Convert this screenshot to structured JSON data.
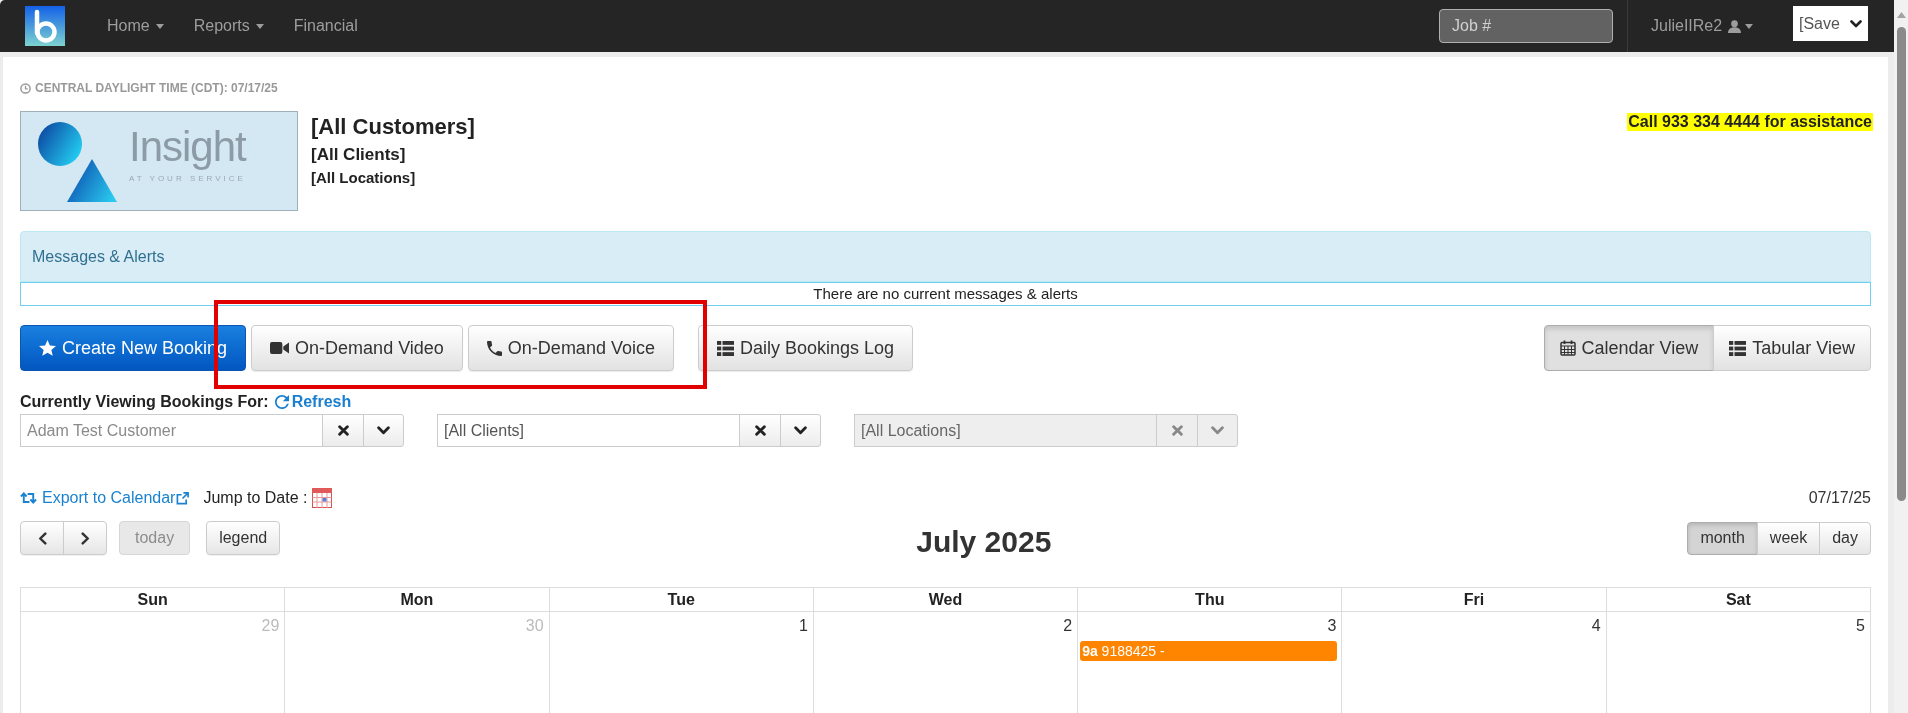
{
  "navbar": {
    "menu": [
      {
        "label": "Home",
        "dropdown": true
      },
      {
        "label": "Reports",
        "dropdown": true
      },
      {
        "label": "Financial",
        "dropdown": false
      }
    ],
    "job_search": {
      "placeholder": "Job #"
    },
    "user": {
      "name": "JulieIIRe2"
    },
    "saved_select": {
      "value": "[Save"
    }
  },
  "timezone": {
    "text": "CENTRAL DAYLIGHT TIME (CDT): 07/17/25"
  },
  "account": {
    "logo": {
      "wordmark": "Insight",
      "tagline": "AT YOUR SERVICE"
    },
    "customer": "[All Customers]",
    "client": "[All Clients]",
    "location": "[All Locations]",
    "assistance": "Call 933 334 4444 for assistance"
  },
  "messages": {
    "title": "Messages & Alerts",
    "empty_text": "There are no current messages & alerts"
  },
  "actions": [
    {
      "label": "Create New Booking",
      "kind": "primary",
      "highlighted": false
    },
    {
      "label": "On-Demand Video",
      "kind": "default",
      "highlighted": true
    },
    {
      "label": "On-Demand Voice",
      "kind": "default",
      "highlighted": true
    },
    {
      "label": "Daily Bookings Log",
      "kind": "default",
      "highlighted": false
    }
  ],
  "view_toggle": [
    {
      "label": "Calendar View",
      "selected": true
    },
    {
      "label": "Tabular View",
      "selected": false
    }
  ],
  "filters": {
    "label": "Currently Viewing Bookings For:",
    "refresh": "Refresh",
    "selects": [
      {
        "placeholder": "Adam Test Customer",
        "disabled": false
      },
      {
        "value": "[All Clients]",
        "disabled": false
      },
      {
        "value": "[All Locations]",
        "disabled": true
      }
    ]
  },
  "calendar": {
    "export": "Export to Calendar",
    "jump_label": "Jump to Date :",
    "current_date": "07/17/25",
    "today": {
      "label": "today",
      "disabled": true
    },
    "legend": "legend",
    "title": "July 2025",
    "views": [
      {
        "label": "month",
        "selected": true
      },
      {
        "label": "week",
        "selected": false
      },
      {
        "label": "day",
        "selected": false
      }
    ],
    "weekdays": [
      "Sun",
      "Mon",
      "Tue",
      "Wed",
      "Thu",
      "Fri",
      "Sat"
    ],
    "days": [
      {
        "number": "29",
        "other_month": true
      },
      {
        "number": "30",
        "other_month": true
      },
      {
        "number": "1",
        "other_month": false
      },
      {
        "number": "2",
        "other_month": false
      },
      {
        "number": "3",
        "other_month": false,
        "events": [
          {
            "time": "9a",
            "title": "9188425 -"
          }
        ]
      },
      {
        "number": "4",
        "other_month": false
      },
      {
        "number": "5",
        "other_month": false
      }
    ]
  }
}
